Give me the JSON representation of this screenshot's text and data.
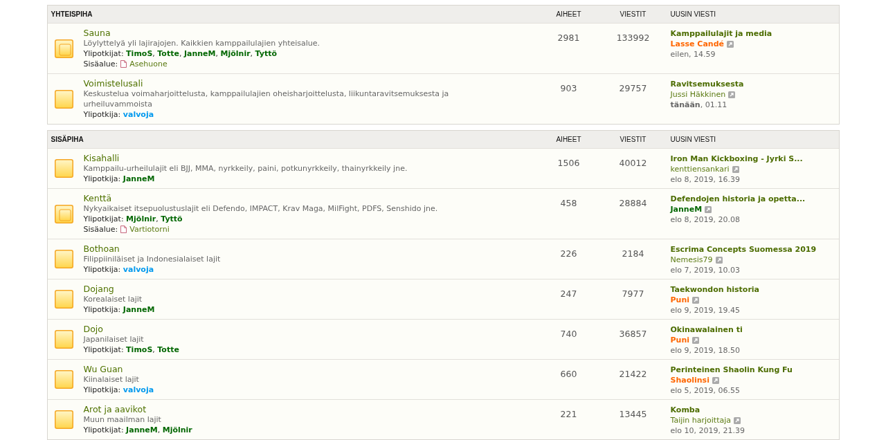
{
  "list_separator": ",",
  "sections": [
    {
      "title": "YHTEISPIHA",
      "columns": [
        "AIHEET",
        "VIESTIT",
        "UUSIN VIESTI"
      ],
      "forums": [
        {
          "title": "Sauna",
          "has_subforums": true,
          "description": "Löylyttelyä yli lajirajojen. Kaikkien kamppailulajien yhteisalue.",
          "moderators": {
            "label": "Ylipotkijat:",
            "names": [
              {
                "name": "TimoS",
                "color": "#006600"
              },
              {
                "name": "Totte",
                "color": "#006600"
              },
              {
                "name": "JanneM",
                "color": "#006600"
              },
              {
                "name": "Mjölnir",
                "color": "#006600"
              },
              {
                "name": "Tyttö",
                "color": "#006600"
              }
            ]
          },
          "subforum": {
            "label": "Sisäalue:",
            "name": "Asehuone"
          },
          "topics": "2981",
          "posts": "133992",
          "last_post": {
            "title": "Kamppailulajit ja media",
            "author": {
              "name": "Lasse Candé",
              "kind": "bold",
              "color": "#ff6600"
            },
            "time": "eilen, 14.59"
          }
        },
        {
          "title": "Voimistelusali",
          "has_subforums": false,
          "description": "Keskustelua voimaharjoittelusta, kamppailulajien oheisharjoittelusta, liikuntaravitsemuksesta ja urheiluvammoista",
          "moderators": {
            "label": "Ylipotkija:",
            "names": [
              {
                "name": "valvoja",
                "color": "#0099ee"
              }
            ]
          },
          "topics": "903",
          "posts": "29757",
          "last_post": {
            "title": "Ravitsemuksesta",
            "author": {
              "name": "Jussi Häkkinen",
              "kind": "plain",
              "color": "#5b7a12"
            },
            "time": "**tänään**, 01.11"
          }
        }
      ]
    },
    {
      "title": "SISÄPIHA",
      "columns": [
        "AIHEET",
        "VIESTIT",
        "UUSIN VIESTI"
      ],
      "forums": [
        {
          "title": "Kisahalli",
          "has_subforums": false,
          "description": "Kamppailu-urheilulajit eli BJJ, MMA, nyrkkeily, paini, potkunyrkkeily, thainyrkkeily jne.",
          "moderators": {
            "label": "Ylipotkija:",
            "names": [
              {
                "name": "JanneM",
                "color": "#006600"
              }
            ]
          },
          "topics": "1506",
          "posts": "40012",
          "last_post": {
            "title": "Iron Man Kickboxing - Jyrki S...",
            "author": {
              "name": "kenttiensankari",
              "kind": "plain",
              "color": "#5b7a12"
            },
            "time": "elo 8, 2019, 16.39"
          }
        },
        {
          "title": "Kenttä",
          "has_subforums": true,
          "description": "Nykyaikaiset itsepuolustuslajit eli Defendo, IMPACT, Krav Maga, MilFight, PDFS, Senshido jne.",
          "moderators": {
            "label": "Ylipotkijat:",
            "names": [
              {
                "name": "Mjölnir",
                "color": "#006600"
              },
              {
                "name": "Tyttö",
                "color": "#006600"
              }
            ]
          },
          "subforum": {
            "label": "Sisäalue:",
            "name": "Vartiotorni"
          },
          "topics": "458",
          "posts": "28884",
          "last_post": {
            "title": "Defendojen historia ja opetta...",
            "author": {
              "name": "JanneM",
              "kind": "bold",
              "color": "#006600"
            },
            "time": "elo 8, 2019, 20.08"
          }
        },
        {
          "title": "Bothoan",
          "has_subforums": false,
          "description": "Filippiiniläiset ja Indonesialaiset lajit",
          "moderators": {
            "label": "Ylipotkija:",
            "names": [
              {
                "name": "valvoja",
                "color": "#0099ee"
              }
            ]
          },
          "topics": "226",
          "posts": "2184",
          "last_post": {
            "title": "Escrima Concepts Suomessa 2019",
            "author": {
              "name": "Nemesis79",
              "kind": "plain",
              "color": "#5b7a12"
            },
            "time": "elo 7, 2019, 10.03"
          }
        },
        {
          "title": "Dojang",
          "has_subforums": false,
          "description": "Korealaiset lajit",
          "moderators": {
            "label": "Ylipotkija:",
            "names": [
              {
                "name": "JanneM",
                "color": "#006600"
              }
            ]
          },
          "topics": "247",
          "posts": "7977",
          "last_post": {
            "title": "Taekwondon historia",
            "author": {
              "name": "Puni",
              "kind": "bold",
              "color": "#ff6600"
            },
            "time": "elo 9, 2019, 19.45"
          }
        },
        {
          "title": "Dojo",
          "has_subforums": false,
          "description": "Japanilaiset lajit",
          "moderators": {
            "label": "Ylipotkijat:",
            "names": [
              {
                "name": "TimoS",
                "color": "#006600"
              },
              {
                "name": "Totte",
                "color": "#006600"
              }
            ]
          },
          "topics": "740",
          "posts": "36857",
          "last_post": {
            "title": "Okinawalainen ti",
            "author": {
              "name": "Puni",
              "kind": "bold",
              "color": "#ff6600"
            },
            "time": "elo 9, 2019, 18.50"
          }
        },
        {
          "title": "Wu Guan",
          "has_subforums": false,
          "description": "Kiinalaiset lajit",
          "moderators": {
            "label": "Ylipotkija:",
            "names": [
              {
                "name": "valvoja",
                "color": "#0099ee"
              }
            ]
          },
          "topics": "660",
          "posts": "21422",
          "last_post": {
            "title": "Perinteinen Shaolin Kung Fu",
            "author": {
              "name": "Shaolinsi",
              "kind": "bold",
              "color": "#ff6600"
            },
            "time": "elo 5, 2019, 06.55"
          }
        },
        {
          "title": "Arot ja aavikot",
          "has_subforums": false,
          "description": "Muun maailman lajit",
          "moderators": {
            "label": "Ylipotkijat:",
            "names": [
              {
                "name": "JanneM",
                "color": "#006600"
              },
              {
                "name": "Mjölnir",
                "color": "#006600"
              }
            ]
          },
          "topics": "221",
          "posts": "13445",
          "last_post": {
            "title": "Komba",
            "author": {
              "name": "Taijin harjoittaja",
              "kind": "plain",
              "color": "#5b7a12"
            },
            "time": "elo 10, 2019, 21.39"
          }
        }
      ]
    }
  ]
}
